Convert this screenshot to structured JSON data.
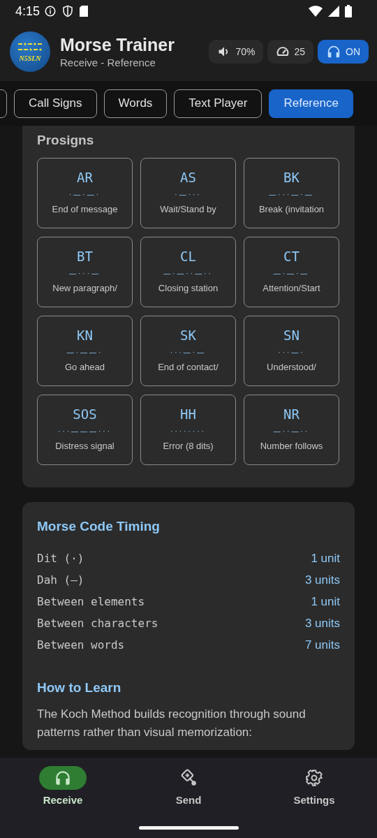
{
  "status_bar": {
    "time": "4:15"
  },
  "app_bar": {
    "title": "Morse Trainer",
    "subtitle": "Receive - Reference",
    "logo_text": "N5SLN",
    "volume": "70%",
    "speed": "25",
    "audio": {
      "label": "ON",
      "on": true
    }
  },
  "tabs": [
    {
      "selected": false
    },
    {
      "label": "Call Signs",
      "selected": false
    },
    {
      "label": "Words",
      "selected": false
    },
    {
      "label": "Text Player",
      "selected": false
    },
    {
      "label": "Reference",
      "selected": true
    }
  ],
  "prosigns": {
    "title": "Prosigns",
    "items": [
      {
        "code": "AR",
        "pattern": "·—·—·",
        "meaning": "End of message"
      },
      {
        "code": "AS",
        "pattern": "·—···",
        "meaning": "Wait/Stand by"
      },
      {
        "code": "BK",
        "pattern": "—···—·—",
        "meaning": "Break (invitation"
      },
      {
        "code": "BT",
        "pattern": "—···—",
        "meaning": "New paragraph/"
      },
      {
        "code": "CL",
        "pattern": "—·—··—··",
        "meaning": "Closing station"
      },
      {
        "code": "CT",
        "pattern": "—·—·—",
        "meaning": "Attention/Start"
      },
      {
        "code": "KN",
        "pattern": "—·——·",
        "meaning": "Go ahead"
      },
      {
        "code": "SK",
        "pattern": "···—·—",
        "meaning": "End of contact/"
      },
      {
        "code": "SN",
        "pattern": "···—·",
        "meaning": "Understood/"
      },
      {
        "code": "SOS",
        "pattern": "···———···",
        "meaning": "Distress signal"
      },
      {
        "code": "HH",
        "pattern": "········",
        "meaning": "Error (8 dits)"
      },
      {
        "code": "NR",
        "pattern": "—··—··",
        "meaning": "Number follows"
      }
    ]
  },
  "timing": {
    "title": "Morse Code Timing",
    "rows": [
      {
        "label": "Dit (·)",
        "value": "1 unit"
      },
      {
        "label": "Dah (—)",
        "value": "3 units"
      },
      {
        "label": "Between elements",
        "value": "1 unit"
      },
      {
        "label": "Between characters",
        "value": "3 units"
      },
      {
        "label": "Between words",
        "value": "7 units"
      }
    ]
  },
  "learn": {
    "title": "How to Learn",
    "text": "The Koch Method builds recognition through sound patterns rather than visual memorization:"
  },
  "bottom_nav": [
    {
      "label": "Receive",
      "selected": true
    },
    {
      "label": "Send",
      "selected": false
    },
    {
      "label": "Settings",
      "selected": false
    }
  ]
}
